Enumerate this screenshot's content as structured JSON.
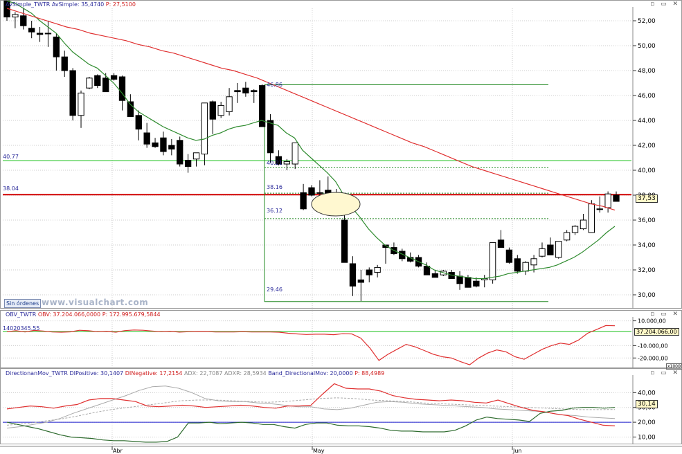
{
  "panels": {
    "price": {
      "header": {
        "series1": "AvSimple_TWTR",
        "series2": "AvSimple:",
        "value2": "35,4740",
        "label3": "P:",
        "value3": "27,5100"
      },
      "sin_ordenes": "Sin órdenes",
      "watermark": "www.visualchart.com",
      "level_labels": {
        "left_4077": "40.77",
        "left_3804": "38.04",
        "r_4686": "46.86",
        "r_4021": "40.21",
        "r_3816": "38.16",
        "r_3612": "36.12",
        "r_2946": "29.46"
      },
      "last_price_tag": "37,53",
      "yticks": [
        "52,00",
        "50,00",
        "48,00",
        "46,00",
        "44,00",
        "42,00",
        "40,00",
        "38,00",
        "36,00",
        "34,00",
        "32,00",
        "30,00"
      ]
    },
    "obv": {
      "header": {
        "name": "OBV_TWTR",
        "label1": "OBV:",
        "value1": "37.204.066,0000",
        "label2": "P:",
        "value2": "172.995.679,5844"
      },
      "level_label": "14020345.55",
      "tag": "37.204.066,00",
      "yticks": [
        "10.000,00",
        "-10.000,00",
        "-20.000,00"
      ],
      "scale_note": "x10000"
    },
    "dmi": {
      "header": {
        "name": "DirectionanMov_TWTR",
        "l1": "DIPositive:",
        "v1": "30,1407",
        "l2": "DINegative:",
        "v2": "17,2154",
        "l3": "ADX:",
        "v3": "22,7087",
        "l4": "ADXR:",
        "v4": "28,5934",
        "l5": "Band_DirectionalMov:",
        "v5": "20,0000",
        "l6": "P:",
        "v6": "88,4989"
      },
      "tag": "30,14",
      "yticks": [
        "40,00",
        "30,00",
        "20,00",
        "10,00"
      ]
    }
  },
  "xaxis_labels": [
    "Abr",
    "May",
    "Jun"
  ],
  "colors": {
    "grid": "#cccccc",
    "up": "#ffffff",
    "down": "#000000",
    "sma_fast": "#2e8b2e",
    "sma_slow": "#e03030",
    "hline_red": "#d00000",
    "hline_green": "#44cc44",
    "fib_green": "#228822",
    "di_pos": "#2e6b2e",
    "di_neg": "#e03030",
    "adx": "#aaaaaa",
    "band": "#1a1acc"
  },
  "chart_data": [
    {
      "type": "candlestick",
      "ylim": [
        29,
        53
      ],
      "x": [
        "Abr",
        "May",
        "Jun"
      ],
      "candles": [
        [
          53.6,
          53.6,
          52.0,
          52.3
        ],
        [
          52.3,
          52.7,
          51.4,
          52.5
        ],
        [
          52.4,
          53.0,
          51.3,
          51.6
        ],
        [
          51.4,
          52.0,
          50.6,
          51.1
        ],
        [
          51.0,
          51.5,
          50.3,
          50.9
        ],
        [
          51.0,
          52.0,
          49.9,
          51.0
        ],
        [
          50.7,
          51.0,
          48.0,
          49.1
        ],
        [
          49.1,
          49.6,
          47.5,
          48.0
        ],
        [
          48.0,
          48.2,
          44.0,
          44.4
        ],
        [
          44.4,
          46.4,
          43.4,
          46.2
        ],
        [
          46.6,
          47.5,
          46.5,
          47.4
        ],
        [
          47.6,
          47.7,
          46.6,
          46.8
        ],
        [
          47.4,
          47.8,
          46.3,
          46.3
        ],
        [
          47.6,
          47.8,
          47.2,
          47.3
        ],
        [
          47.5,
          47.6,
          44.8,
          45.6
        ],
        [
          45.5,
          46.1,
          44.5,
          44.3
        ],
        [
          44.4,
          44.8,
          42.4,
          43.3
        ],
        [
          43.0,
          43.8,
          41.8,
          42.1
        ],
        [
          42.2,
          42.6,
          41.8,
          41.9
        ],
        [
          42.6,
          43.1,
          41.2,
          41.5
        ],
        [
          42.0,
          42.5,
          41.2,
          41.7
        ],
        [
          42.4,
          42.7,
          40.3,
          40.5
        ],
        [
          40.8,
          41.3,
          39.8,
          40.3
        ],
        [
          40.9,
          41.3,
          40.3,
          41.4
        ],
        [
          41.3,
          42.4,
          40.4,
          45.4
        ],
        [
          45.5,
          45.6,
          42.9,
          44.1
        ],
        [
          44.4,
          45.5,
          44.2,
          45.2
        ],
        [
          44.7,
          46.6,
          44.4,
          45.9
        ],
        [
          46.4,
          47.0,
          45.4,
          46.3
        ],
        [
          46.6,
          47.1,
          45.9,
          46.2
        ],
        [
          46.4,
          46.5,
          45.4,
          46.3
        ],
        [
          46.8,
          46.9,
          44.9,
          43.5
        ],
        [
          44.0,
          44.5,
          40.6,
          41.4
        ],
        [
          41.1,
          41.6,
          40.4,
          40.5
        ],
        [
          40.5,
          40.9,
          40.0,
          40.7
        ],
        [
          40.5,
          41.7,
          40.1,
          42.2
        ],
        [
          38.2,
          38.9,
          36.8,
          36.9
        ],
        [
          38.6,
          38.8,
          37.9,
          38.0
        ],
        [
          38.2,
          39.2,
          38.0,
          38.2
        ],
        [
          38.4,
          39.5,
          37.8,
          37.8
        ],
        [
          38.0,
          38.5,
          37.5,
          37.8
        ],
        [
          36.0,
          36.5,
          32.8,
          32.6
        ],
        [
          32.5,
          33.1,
          29.9,
          30.7
        ],
        [
          31.2,
          32.0,
          29.5,
          31.0
        ],
        [
          32.0,
          32.2,
          31.0,
          31.6
        ],
        [
          31.8,
          32.4,
          31.4,
          32.2
        ],
        [
          34.0,
          34.0,
          32.5,
          33.8
        ],
        [
          33.8,
          34.2,
          33.2,
          33.3
        ],
        [
          33.5,
          33.7,
          32.7,
          32.9
        ],
        [
          33.0,
          33.4,
          32.6,
          32.7
        ],
        [
          33.0,
          33.2,
          32.2,
          32.3
        ],
        [
          32.3,
          32.6,
          31.7,
          31.6
        ],
        [
          31.7,
          32.0,
          31.4,
          31.4
        ],
        [
          31.6,
          32.0,
          31.5,
          31.9
        ],
        [
          31.8,
          32.0,
          31.3,
          31.3
        ],
        [
          31.5,
          31.9,
          30.4,
          30.9
        ],
        [
          31.4,
          31.6,
          30.8,
          30.6
        ],
        [
          31.1,
          31.4,
          30.6,
          30.7
        ],
        [
          31.2,
          31.6,
          30.6,
          31.3
        ],
        [
          31.2,
          34.2,
          30.9,
          34.2
        ],
        [
          34.4,
          35.2,
          34.0,
          33.8
        ],
        [
          33.6,
          33.8,
          32.5,
          32.6
        ],
        [
          32.9,
          33.2,
          31.7,
          31.9
        ],
        [
          31.9,
          32.7,
          31.6,
          32.6
        ],
        [
          32.4,
          33.2,
          31.8,
          32.9
        ],
        [
          33.1,
          34.2,
          33.0,
          33.7
        ],
        [
          34.0,
          34.6,
          33.2,
          33.2
        ],
        [
          33.0,
          34.2,
          32.9,
          34.3
        ],
        [
          34.4,
          35.2,
          34.3,
          35.0
        ],
        [
          35.0,
          35.6,
          34.8,
          35.5
        ],
        [
          35.3,
          36.5,
          35.2,
          36.0
        ],
        [
          35.0,
          37.6,
          35.0,
          37.3
        ],
        [
          36.9,
          37.9,
          36.6,
          36.9
        ],
        [
          37.0,
          38.3,
          36.6,
          38.1
        ],
        [
          38.0,
          38.3,
          37.5,
          37.5
        ]
      ],
      "sma_fast": [
        53.6,
        53.4,
        53.0,
        52.6,
        52.0,
        51.5,
        51.0,
        50.2,
        49.5,
        49.0,
        48.5,
        48.2,
        47.6,
        47.0,
        46.2,
        45.3,
        44.7,
        44.3,
        43.9,
        43.5,
        43.2,
        42.9,
        42.6,
        42.4,
        42.5,
        42.8,
        43.0,
        43.3,
        43.5,
        43.6,
        43.8,
        44.0,
        43.8,
        43.6,
        43.0,
        42.6,
        41.6,
        41.0,
        40.4,
        39.8,
        39.1,
        38.0,
        37.0,
        36.2,
        35.3,
        34.6,
        34.0,
        33.6,
        33.3,
        33.0,
        32.7,
        32.4,
        32.0,
        31.8,
        31.6,
        31.5,
        31.4,
        31.3,
        31.3,
        31.4,
        31.5,
        31.7,
        31.8,
        31.9,
        32.0,
        32.1,
        32.2,
        32.4,
        32.7,
        33.0,
        33.4,
        33.9,
        34.4,
        35.0,
        35.5
      ],
      "sma_slow": [
        53.0,
        52.7,
        52.4,
        52.1,
        51.8,
        51.5,
        51.3,
        51.0,
        50.8,
        50.6,
        50.4,
        50.1,
        49.9,
        49.6,
        49.4,
        49.1,
        48.8,
        48.5,
        48.2,
        48.0,
        47.7,
        47.4,
        47.0,
        46.6,
        46.2,
        45.8,
        45.4,
        45.0,
        44.6,
        44.2,
        43.8,
        43.4,
        43.0,
        42.6,
        42.2,
        41.9,
        41.5,
        41.1,
        40.7,
        40.3,
        40.0,
        39.7,
        39.4,
        39.1,
        38.8,
        38.5,
        38.2,
        37.9,
        37.6,
        37.3,
        37.1,
        36.8
      ],
      "hlines": {
        "red": 38.04,
        "green": 40.77
      },
      "fib": {
        "top": 46.86,
        "bottom": 29.46,
        "levels": [
          40.21,
          38.16,
          36.12
        ]
      }
    },
    {
      "type": "line",
      "name": "OBV",
      "ylim": [
        -26,
        12
      ],
      "values": [
        1.2,
        2.0,
        1.0,
        2.3,
        1.8,
        1.0,
        0.8,
        1.1,
        2.4,
        2.0,
        1.2,
        1.6,
        0.8,
        2.1,
        2.6,
        2.4,
        1.8,
        1.2,
        1.6,
        0.9,
        1.2,
        1.4,
        1.4,
        1.0,
        1.0,
        1.0,
        1.2,
        1.0,
        1.0,
        1.0,
        0.8,
        0.0,
        -0.6,
        -1.0,
        -0.8,
        -0.8,
        -1.2,
        -0.4,
        -0.6,
        -4.0,
        -12.0,
        -22.0,
        -17.0,
        -13.0,
        -9.0,
        -11.0,
        -14.0,
        -17.0,
        -19.0,
        -20.0,
        -23.0,
        -25.5,
        -20.0,
        -16.0,
        -13.5,
        -15.0,
        -19.0,
        -21.0,
        -17.0,
        -13.0,
        -10.0,
        -8.0,
        -9.0,
        -5.5,
        0.0,
        3.0,
        6.2,
        6.0
      ],
      "hline": 1.4
    },
    {
      "type": "line",
      "ylim": [
        6,
        50
      ],
      "series": [
        {
          "name": "DIPositive",
          "values": [
            20.0,
            18.5,
            17.0,
            15.5,
            13.5,
            11.5,
            10.0,
            9.5,
            9.0,
            8.0,
            7.5,
            7.5,
            7.0,
            6.5,
            6.5,
            7.0,
            10.0,
            19.5,
            19.5,
            20.0,
            19.0,
            19.5,
            20.0,
            19.5,
            18.5,
            18.5,
            17.0,
            16.0,
            18.5,
            19.5,
            19.5,
            18.0,
            17.5,
            17.5,
            17.0,
            16.0,
            14.5,
            14.0,
            14.0,
            13.5,
            13.5,
            13.5,
            14.5,
            17.5,
            21.5,
            23.5,
            22.5,
            22.0,
            21.5,
            20.5,
            26.0,
            27.5,
            28.0,
            29.5,
            30.0,
            30.0,
            29.5,
            30.0
          ]
        },
        {
          "name": "DINegative",
          "values": [
            29.0,
            30.0,
            31.0,
            30.5,
            29.5,
            31.0,
            32.0,
            35.0,
            36.0,
            36.0,
            35.0,
            34.0,
            31.0,
            30.5,
            31.0,
            31.5,
            31.0,
            30.0,
            30.5,
            31.0,
            31.5,
            31.0,
            30.0,
            29.5,
            31.0,
            31.0,
            31.5,
            39.0,
            46.0,
            43.0,
            42.5,
            42.5,
            41.0,
            38.0,
            36.5,
            35.5,
            35.0,
            34.5,
            35.0,
            34.5,
            33.5,
            33.0,
            35.0,
            32.5,
            30.0,
            28.0,
            27.0,
            25.5,
            24.5,
            22.0,
            20.0,
            18.0,
            17.5
          ]
        },
        {
          "name": "ADX",
          "values": [
            16.0,
            17.0,
            18.5,
            20.0,
            22.5,
            26.0,
            29.0,
            32.0,
            35.0,
            38.0,
            41.5,
            44.0,
            44.5,
            43.0,
            40.0,
            36.0,
            34.5,
            34.0,
            34.0,
            33.0,
            32.5,
            31.5,
            30.5,
            30.5,
            29.0,
            28.5,
            29.5,
            31.5,
            33.5,
            34.0,
            33.5,
            32.5,
            32.0,
            31.5,
            31.0,
            30.5,
            30.0,
            29.0,
            28.5,
            28.0,
            27.5,
            26.5,
            25.0,
            24.5,
            23.5,
            23.0,
            22.5
          ]
        },
        {
          "name": "ADXR",
          "values": [
            18.0,
            19.0,
            20.5,
            22.0,
            24.0,
            26.5,
            28.5,
            30.0,
            31.5,
            33.0,
            34.5,
            35.0,
            35.0,
            34.5,
            34.0,
            33.5,
            34.0,
            35.0,
            36.0,
            36.5,
            36.0,
            35.0,
            34.5,
            34.0,
            33.0,
            32.5,
            32.0,
            31.5,
            31.0,
            30.5,
            30.0,
            29.5,
            29.0,
            28.5,
            28.5,
            28.6
          ]
        },
        {
          "name": "Band_DirectionalMov",
          "values": [
            20.0
          ]
        }
      ]
    }
  ]
}
